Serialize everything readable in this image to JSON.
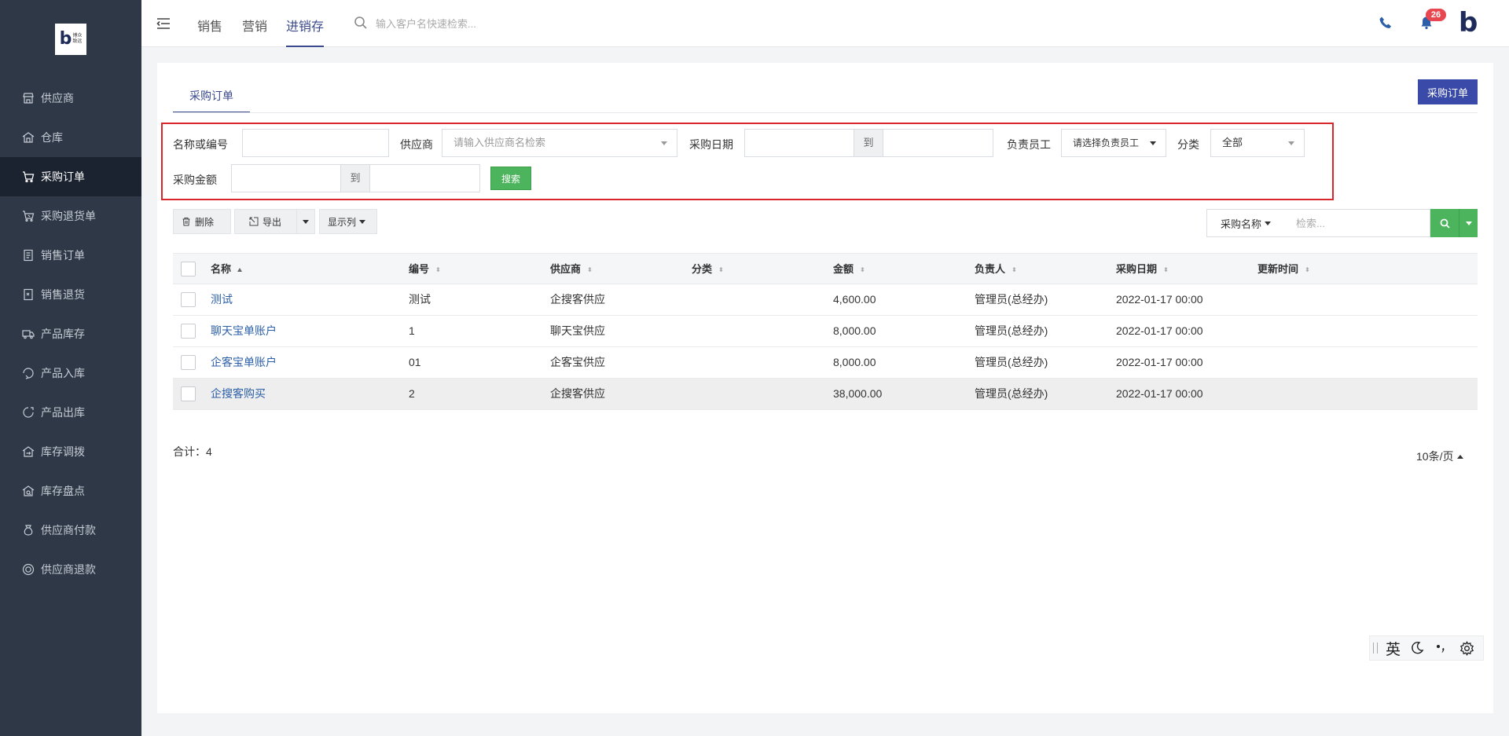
{
  "brand": {
    "mark": "b",
    "line1": "博众",
    "line2": "致远"
  },
  "sidebar": {
    "items": [
      {
        "label": "供应商",
        "icon": "store-icon",
        "active": false
      },
      {
        "label": "仓库",
        "icon": "warehouse-icon",
        "active": false
      },
      {
        "label": "采购订单",
        "icon": "cart-icon",
        "active": true
      },
      {
        "label": "采购退货单",
        "icon": "cart-return-icon",
        "active": false
      },
      {
        "label": "销售订单",
        "icon": "order-list-icon",
        "active": false
      },
      {
        "label": "销售退货",
        "icon": "return-doc-icon",
        "active": false
      },
      {
        "label": "产品库存",
        "icon": "truck-icon",
        "active": false
      },
      {
        "label": "产品入库",
        "icon": "stock-in-icon",
        "active": false
      },
      {
        "label": "产品出库",
        "icon": "stock-out-icon",
        "active": false
      },
      {
        "label": "库存调拨",
        "icon": "transfer-icon",
        "active": false
      },
      {
        "label": "库存盘点",
        "icon": "inventory-check-icon",
        "active": false
      },
      {
        "label": "供应商付款",
        "icon": "money-bag-icon",
        "active": false
      },
      {
        "label": "供应商退款",
        "icon": "refund-icon",
        "active": false
      }
    ]
  },
  "header": {
    "tabs": [
      {
        "label": "销售",
        "active": false
      },
      {
        "label": "营销",
        "active": false
      },
      {
        "label": "进销存",
        "active": true
      }
    ],
    "search_placeholder": "输入客户名快速检索...",
    "notification_count": "26",
    "avatar_mark": "b"
  },
  "card": {
    "tab_label": "采购订单",
    "action_button": "采购订单"
  },
  "filters": {
    "name_label": "名称或编号",
    "supplier_label": "供应商",
    "supplier_placeholder": "请输入供应商名检索",
    "date_label": "采购日期",
    "to_label": "到",
    "staff_label": "负责员工",
    "staff_select": "请选择负责员工",
    "category_label": "分类",
    "category_select": "全部",
    "amount_label": "采购金额",
    "search_button": "搜索"
  },
  "toolbar": {
    "delete": "删除",
    "export": "导出",
    "columns": "显示列",
    "search_field": "采购名称",
    "search_placeholder": "检索..."
  },
  "table": {
    "columns": [
      "名称",
      "编号",
      "供应商",
      "分类",
      "金额",
      "负责人",
      "采购日期",
      "更新时间"
    ],
    "rows": [
      {
        "name": "测试",
        "code": "测试",
        "supplier": "企搜客供应",
        "category": "",
        "amount": "4,600.00",
        "owner": "管理员(总经办)",
        "date": "2022-01-17 00:00",
        "updated": ""
      },
      {
        "name": "聊天宝单账户",
        "code": "1",
        "supplier": "聊天宝供应",
        "category": "",
        "amount": "8,000.00",
        "owner": "管理员(总经办)",
        "date": "2022-01-17 00:00",
        "updated": ""
      },
      {
        "name": "企客宝单账户",
        "code": "01",
        "supplier": "企客宝供应",
        "category": "",
        "amount": "8,000.00",
        "owner": "管理员(总经办)",
        "date": "2022-01-17 00:00",
        "updated": ""
      },
      {
        "name": "企搜客购买",
        "code": "2",
        "supplier": "企搜客供应",
        "category": "",
        "amount": "38,000.00",
        "owner": "管理员(总经办)",
        "date": "2022-01-17 00:00",
        "updated": ""
      }
    ]
  },
  "footer": {
    "total": "合计：4",
    "page_size": "10条/页"
  },
  "ime": {
    "lang": "英"
  },
  "colors": {
    "sidebar": "#2f3847",
    "accent": "#3a4aa8",
    "success": "#4cb45c",
    "highlight": "#d9262a"
  }
}
